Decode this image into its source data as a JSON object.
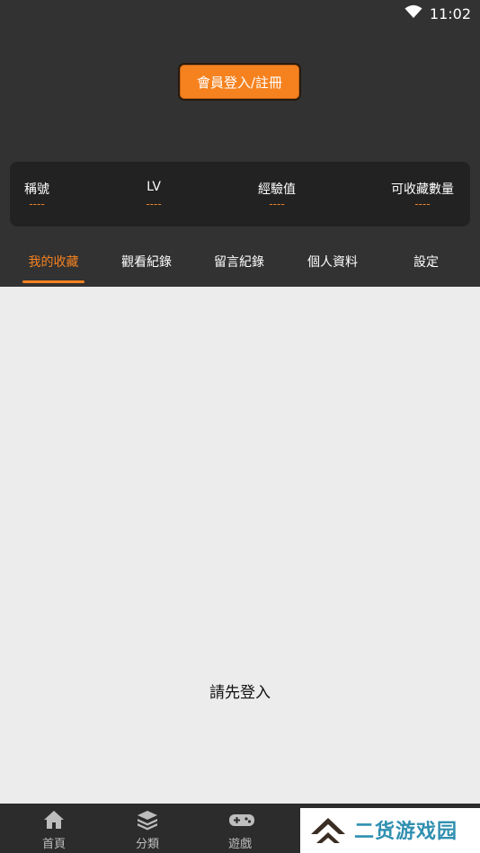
{
  "status_bar": {
    "time": "11:02"
  },
  "login_button": {
    "label": "會員登入/註冊"
  },
  "stats": [
    {
      "label": "稱號",
      "value": "----"
    },
    {
      "label": "LV",
      "value": "----"
    },
    {
      "label": "經驗值",
      "value": "----"
    },
    {
      "label": "可收藏數量",
      "value": "----"
    }
  ],
  "tabs": [
    {
      "label": "我的收藏",
      "active": true
    },
    {
      "label": "觀看紀錄",
      "active": false
    },
    {
      "label": "留言紀錄",
      "active": false
    },
    {
      "label": "個人資料",
      "active": false
    },
    {
      "label": "設定",
      "active": false
    }
  ],
  "content": {
    "empty_message": "請先登入"
  },
  "bottom_nav": [
    {
      "label": "首頁",
      "icon": "home-icon"
    },
    {
      "label": "分類",
      "icon": "layers-icon"
    },
    {
      "label": "遊戲",
      "icon": "gamepad-icon"
    }
  ],
  "watermark": {
    "text": "二货游戏园"
  },
  "colors": {
    "accent": "#f5821f",
    "header_bg": "#323232",
    "content_bg": "#ececec"
  }
}
